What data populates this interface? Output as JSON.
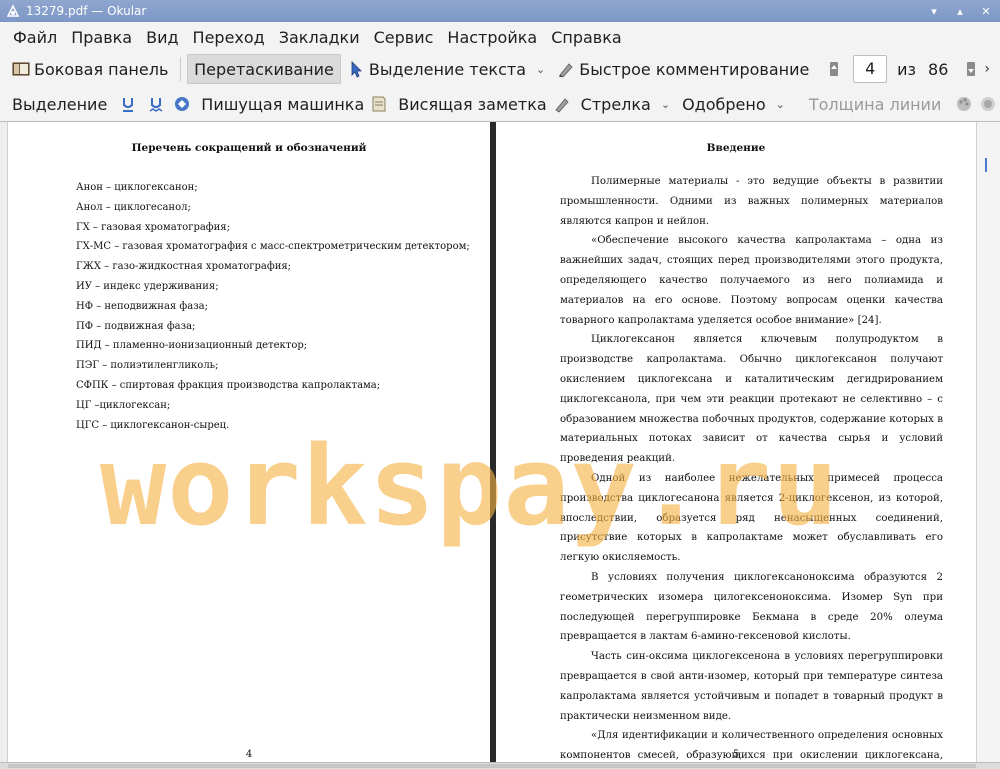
{
  "window": {
    "title": "13279.pdf  — Okular"
  },
  "menu": [
    "Файл",
    "Правка",
    "Вид",
    "Переход",
    "Закладки",
    "Сервис",
    "Настройка",
    "Справка"
  ],
  "toolbar1": {
    "sidebar": "Боковая панель",
    "drag": "Перетаскивание",
    "text_select": "Выделение текста",
    "quick_comment": "Быстрое комментирование",
    "page_current": "4",
    "page_of": "из",
    "page_total": "86"
  },
  "toolbar2": {
    "selection": "Выделение",
    "typewriter": "Пишущая машинка",
    "sticky_note": "Висящая заметка",
    "arrow": "Стрелка",
    "approved": "Одобрено",
    "line_width": "Толщина линии"
  },
  "left_page": {
    "heading": "Перечень сокращений и обозначений",
    "items": [
      "Анон – циклогексанон;",
      "Анол – циклогесанол;",
      "ГХ – газовая хроматография;",
      "ГХ-МС – газовая хроматография с масс-спектрометрическим детектором;",
      "ГЖХ – газо-жидкостная хроматография;",
      "ИУ – индекс удерживания;",
      "НФ – неподвижная фаза;",
      "ПФ – подвижная фаза;",
      "ПИД – пламенно-ионизационный детектор;",
      "ПЭГ – полиэтиленгликоль;",
      "СФПК – спиртовая фракция производства капролактама;",
      "ЦГ –циклогексан;",
      "ЦГС – циклогексанон-сырец."
    ],
    "page_number": "4"
  },
  "right_page": {
    "heading": "Введение",
    "paragraphs": [
      "Полимерные материалы - это ведущие объекты в развитии промышленности. Одними из важных полимерных материалов являются капрон и нейлон.",
      "«Обеспечение высокого качества капролактама – одна из важнейших задач, стоящих перед производителями этого продукта, определяющего качество получаемого из него полиамида и материалов на его основе. Поэтому вопросам оценки качества товарного капролактама уделяется особое внимание» [24].",
      "Циклогексанон является ключевым полупродуктом в производстве капролактама. Обычно циклогексанон получают окислением циклогексана и каталитическим дегидрированием циклогексанола, при чем эти реакции протекают не селективно – с образованием множества побочных продуктов, содержание которых в материальных потоках зависит от качества сырья и условий проведения реакций.",
      "Одной из наиболее нежелательных примесей процесса производства циклогесанона является 2-циклогексенон, из которой, впоследствии, образуется ряд ненасыщенных соединений, присутствие которых в капролактаме может обуславливать его легкую окисляемость.",
      "В условиях получения циклогексаноноксима образуются 2 геометрических изомера цилогексеноноксима. Изомер Syn при последующей перегруппировке Бекмана в среде 20% олеума превращается в лактам 6-амино-гексеновой кислоты.",
      "Часть син-оксима циклогексенона в условиях перегруппировки превращается в свой анти-изомер, который при температуре синтеза капролактама является устойчивым и попадет в товарный продукт в практически неизменном виде.",
      "«Для идентификации и количественного определения основных компонентов смесей, образующихся при окислении циклогексана, наиболее"
    ],
    "page_number": "5"
  },
  "watermark": "workspay.ru"
}
